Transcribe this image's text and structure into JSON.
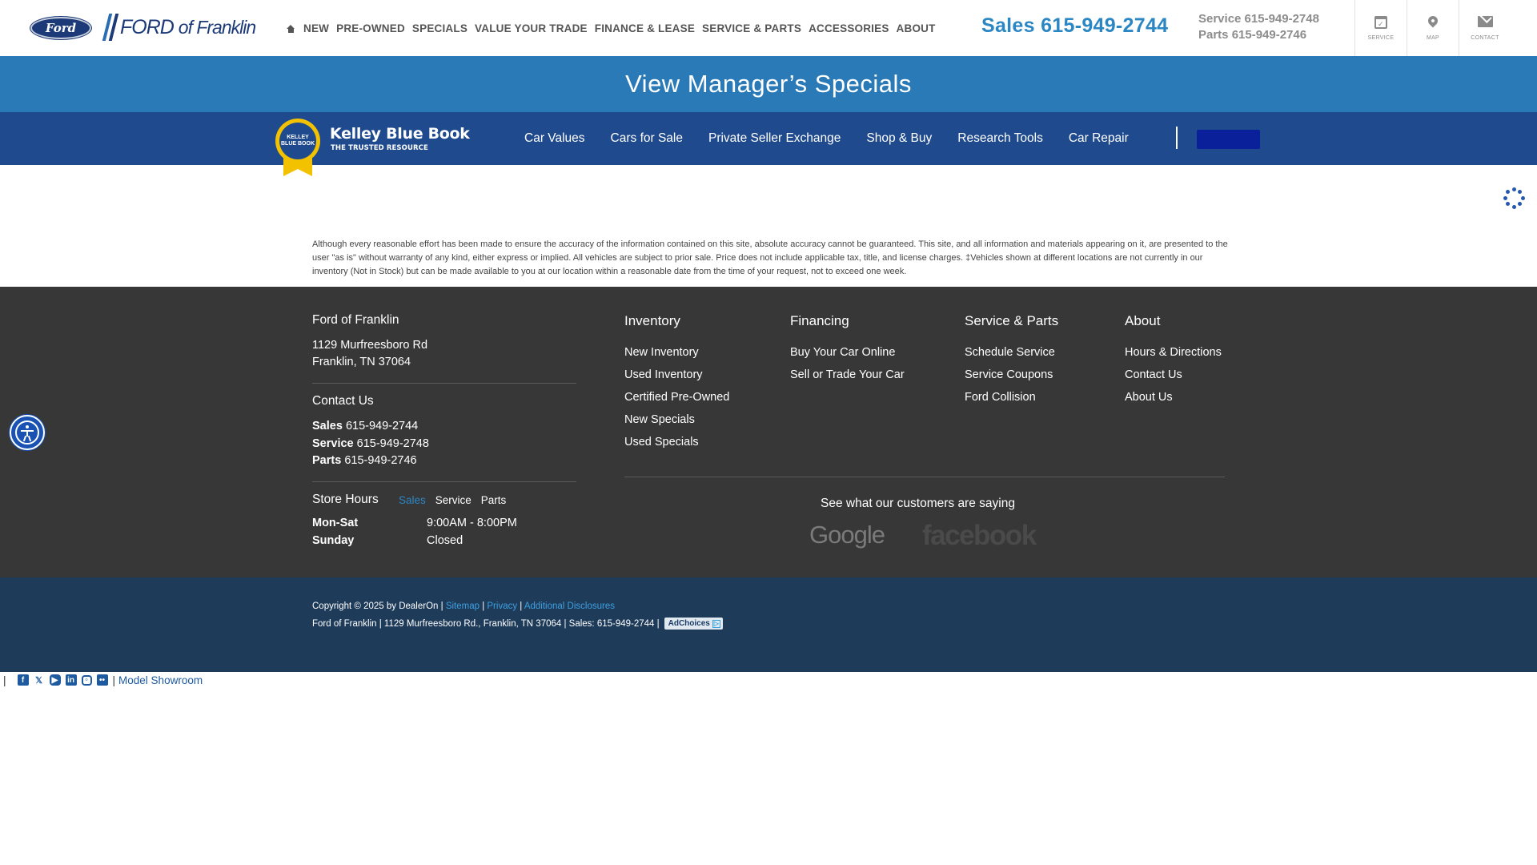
{
  "header": {
    "brand_oval": "Ford",
    "dealer_prefix": "FORD",
    "dealer_of": "of Franklin",
    "nav": [
      "NEW",
      "PRE-OWNED",
      "SPECIALS",
      "VALUE YOUR TRADE",
      "FINANCE & LEASE",
      "SERVICE & PARTS",
      "ACCESSORIES",
      "ABOUT"
    ],
    "sales_phone": "Sales 615-949-2744",
    "service_phone": "Service 615-949-2748",
    "parts_phone": "Parts 615-949-2746",
    "icons": [
      {
        "name": "calendar-icon",
        "label": "SERVICE"
      },
      {
        "name": "map-pin-icon",
        "label": "MAP"
      },
      {
        "name": "envelope-icon",
        "label": "CONTACT"
      }
    ]
  },
  "banner": {
    "text": "View Manager’s Specials"
  },
  "kbb": {
    "title": "Kelley Blue Book",
    "subtitle": "THE TRUSTED RESOURCE",
    "seal_text": "KELLEY BLUE BOOK",
    "nav": [
      "Car Values",
      "Cars for Sale",
      "Private Seller Exchange",
      "Shop & Buy",
      "Research Tools",
      "Car Repair"
    ]
  },
  "disclaimer": "Although every reasonable effort has been made to ensure the accuracy of the information contained on this site, absolute accuracy cannot be guaranteed. This site, and all information and materials appearing on it, are presented to the user \"as is\" without warranty of any kind, either express or implied. All vehicles are subject to prior sale. Price does not include applicable tax, title, and license charges. ‡Vehicles shown at different locations are not currently in our inventory (Not in Stock) but can be made available to you at our location within a reasonable date from the time of your request, not to exceed one week.",
  "footer": {
    "dealer_name": "Ford of Franklin",
    "address_line1": "1129 Murfreesboro Rd",
    "address_line2": "Franklin, TN 37064",
    "contact_heading": "Contact Us",
    "contacts": [
      {
        "label": "Sales",
        "phone": "615-949-2744"
      },
      {
        "label": "Service",
        "phone": "615-949-2748"
      },
      {
        "label": "Parts",
        "phone": "615-949-2746"
      }
    ],
    "hours_heading": "Store Hours",
    "hours_tabs": [
      "Sales",
      "Service",
      "Parts"
    ],
    "hours_active_tab": "Sales",
    "hours": [
      {
        "day": "Mon-Sat",
        "time": "9:00AM - 8:00PM"
      },
      {
        "day": "Sunday",
        "time": "Closed"
      }
    ],
    "columns": [
      {
        "heading": "Inventory",
        "links": [
          "New Inventory",
          "Used Inventory",
          "Certified Pre-Owned",
          "New Specials",
          "Used Specials"
        ]
      },
      {
        "heading": "Financing",
        "links": [
          "Buy Your Car Online",
          "Sell or Trade Your Car"
        ]
      },
      {
        "heading": "Service & Parts",
        "links": [
          "Schedule Service",
          "Service Coupons",
          "Ford Collision"
        ]
      },
      {
        "heading": "About",
        "links": [
          "Hours & Directions",
          "Contact Us",
          "About Us"
        ]
      }
    ],
    "reviews_heading": "See what our customers are saying",
    "review_sites": [
      "Google",
      "facebook"
    ]
  },
  "bottombar": {
    "copyright": "Copyright © 2025 by DealerOn |",
    "links": [
      "Sitemap",
      "Privacy",
      "Additional Disclosures"
    ],
    "address_line": "Ford of Franklin | 1129 Murfreesboro Rd., Franklin, TN 37064 | Sales: 615-949-2744 |",
    "adchoices": "AdChoices"
  },
  "social": {
    "icons": [
      "facebook-icon",
      "x-icon",
      "youtube-icon",
      "linkedin-icon",
      "instagram-icon",
      "flickr-icon"
    ],
    "model_showroom": "Model Showroom"
  },
  "colors": {
    "accent_blue": "#2b86c4",
    "banner": "#2a7ab8",
    "kbb_bar": "#1f4a8e",
    "footer": "#373737",
    "bottombar": "#1e3b5a"
  }
}
